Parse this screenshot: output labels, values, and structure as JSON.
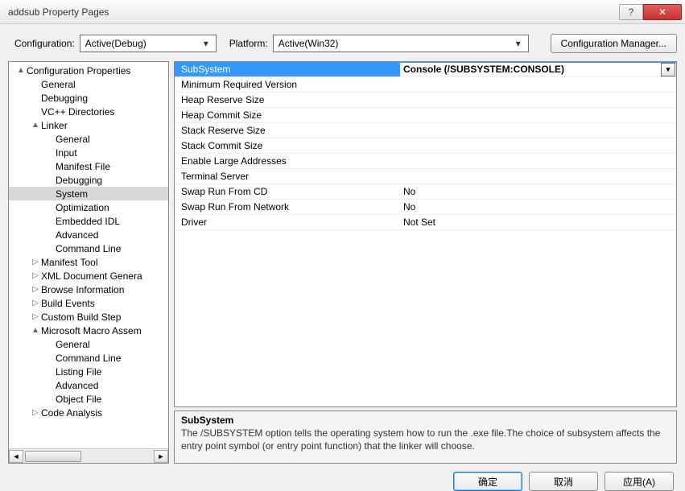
{
  "title": "addsub Property Pages",
  "config": {
    "label_configuration": "Configuration:",
    "configuration_value": "Active(Debug)",
    "label_platform": "Platform:",
    "platform_value": "Active(Win32)",
    "config_manager_btn": "Configuration Manager..."
  },
  "tree": [
    {
      "label": "Configuration Properties",
      "depth": 0,
      "exp": "▲"
    },
    {
      "label": "General",
      "depth": 1,
      "exp": ""
    },
    {
      "label": "Debugging",
      "depth": 1,
      "exp": ""
    },
    {
      "label": "VC++ Directories",
      "depth": 1,
      "exp": ""
    },
    {
      "label": "Linker",
      "depth": 1,
      "exp": "▲"
    },
    {
      "label": "General",
      "depth": 2,
      "exp": ""
    },
    {
      "label": "Input",
      "depth": 2,
      "exp": ""
    },
    {
      "label": "Manifest File",
      "depth": 2,
      "exp": ""
    },
    {
      "label": "Debugging",
      "depth": 2,
      "exp": ""
    },
    {
      "label": "System",
      "depth": 2,
      "exp": "",
      "selected": true
    },
    {
      "label": "Optimization",
      "depth": 2,
      "exp": ""
    },
    {
      "label": "Embedded IDL",
      "depth": 2,
      "exp": ""
    },
    {
      "label": "Advanced",
      "depth": 2,
      "exp": ""
    },
    {
      "label": "Command Line",
      "depth": 2,
      "exp": ""
    },
    {
      "label": "Manifest Tool",
      "depth": 1,
      "exp": "▷"
    },
    {
      "label": "XML Document Genera",
      "depth": 1,
      "exp": "▷"
    },
    {
      "label": "Browse Information",
      "depth": 1,
      "exp": "▷"
    },
    {
      "label": "Build Events",
      "depth": 1,
      "exp": "▷"
    },
    {
      "label": "Custom Build Step",
      "depth": 1,
      "exp": "▷"
    },
    {
      "label": "Microsoft Macro Assem",
      "depth": 1,
      "exp": "▲"
    },
    {
      "label": "General",
      "depth": 2,
      "exp": ""
    },
    {
      "label": "Command Line",
      "depth": 2,
      "exp": ""
    },
    {
      "label": "Listing File",
      "depth": 2,
      "exp": ""
    },
    {
      "label": "Advanced",
      "depth": 2,
      "exp": ""
    },
    {
      "label": "Object File",
      "depth": 2,
      "exp": ""
    },
    {
      "label": "Code Analysis",
      "depth": 1,
      "exp": "▷"
    }
  ],
  "grid": [
    {
      "prop": "SubSystem",
      "val": "Console (/SUBSYSTEM:CONSOLE)",
      "selected": true
    },
    {
      "prop": "Minimum Required Version",
      "val": ""
    },
    {
      "prop": "Heap Reserve Size",
      "val": ""
    },
    {
      "prop": "Heap Commit Size",
      "val": ""
    },
    {
      "prop": "Stack Reserve Size",
      "val": ""
    },
    {
      "prop": "Stack Commit Size",
      "val": ""
    },
    {
      "prop": "Enable Large Addresses",
      "val": ""
    },
    {
      "prop": "Terminal Server",
      "val": ""
    },
    {
      "prop": "Swap Run From CD",
      "val": "No"
    },
    {
      "prop": "Swap Run From Network",
      "val": "No"
    },
    {
      "prop": "Driver",
      "val": "Not Set"
    }
  ],
  "desc": {
    "title": "SubSystem",
    "text": "The /SUBSYSTEM option tells the operating system how to run the .exe file.The choice of subsystem affects the entry point symbol (or entry point function) that the linker will choose."
  },
  "footer": {
    "ok": "确定",
    "cancel": "取消",
    "apply": "应用(A)"
  }
}
